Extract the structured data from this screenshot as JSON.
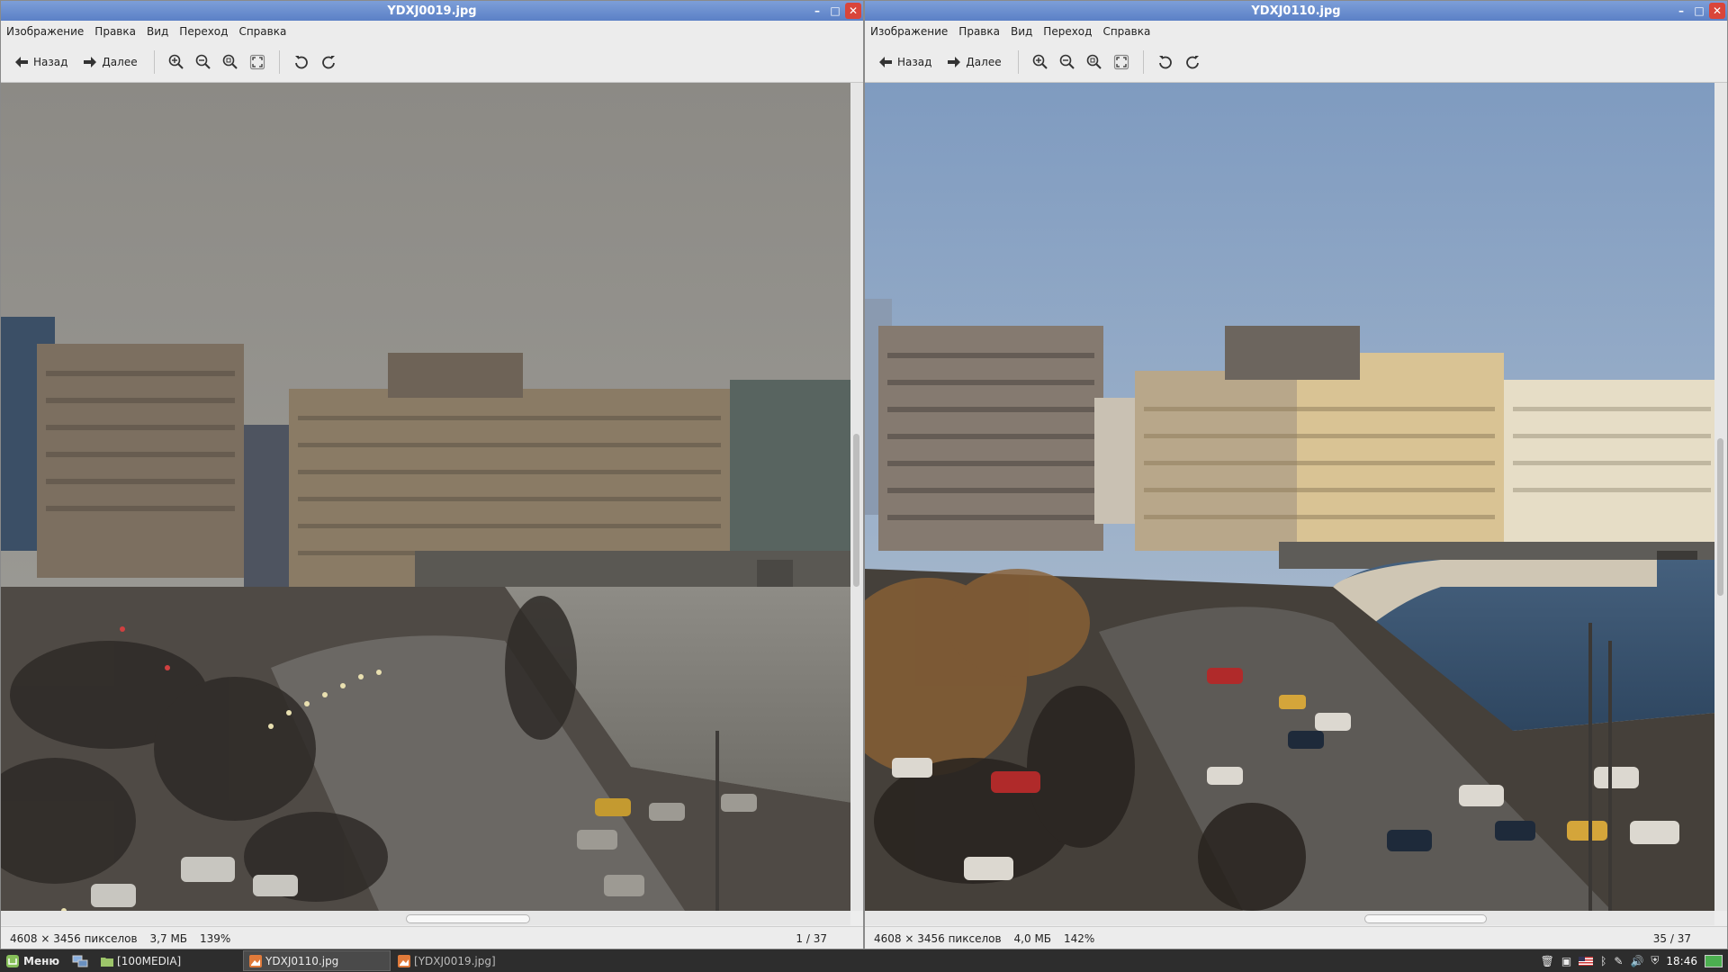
{
  "colors": {
    "titlebar": "#6a8ccf",
    "close": "#d9453a",
    "taskbar": "#2d2d2d"
  },
  "windows": [
    {
      "title": "YDXJ0019.jpg",
      "menu": [
        "Изображение",
        "Правка",
        "Вид",
        "Переход",
        "Справка"
      ],
      "toolbar": {
        "back": "Назад",
        "forward": "Далее"
      },
      "status": {
        "dims": "4608 × 3456 пикселов",
        "size": "3,7 МБ",
        "zoom": "139%",
        "page": "1 / 37"
      },
      "scroll": {
        "vertical": 0.5,
        "horizontal": 0.5
      },
      "photo_tone": "overcast"
    },
    {
      "title": "YDXJ0110.jpg",
      "menu": [
        "Изображение",
        "Правка",
        "Вид",
        "Переход",
        "Справка"
      ],
      "toolbar": {
        "back": "Назад",
        "forward": "Далее"
      },
      "status": {
        "dims": "4608 × 3456 пикселов",
        "size": "4,0 МБ",
        "zoom": "142%",
        "page": "35 / 37"
      },
      "scroll": {
        "vertical": 0.5,
        "horizontal": 0.5
      },
      "photo_tone": "sunny"
    }
  ],
  "taskbar": {
    "menu_label": "Меню",
    "tasks": [
      {
        "label": "[100MEDIA]",
        "icon": "folder-icon",
        "active": false
      },
      {
        "label": "YDXJ0110.jpg",
        "icon": "image-viewer-icon",
        "active": true
      },
      {
        "label": "[YDXJ0019.jpg]",
        "icon": "image-viewer-icon",
        "active": false
      }
    ],
    "clock": "18:46"
  }
}
